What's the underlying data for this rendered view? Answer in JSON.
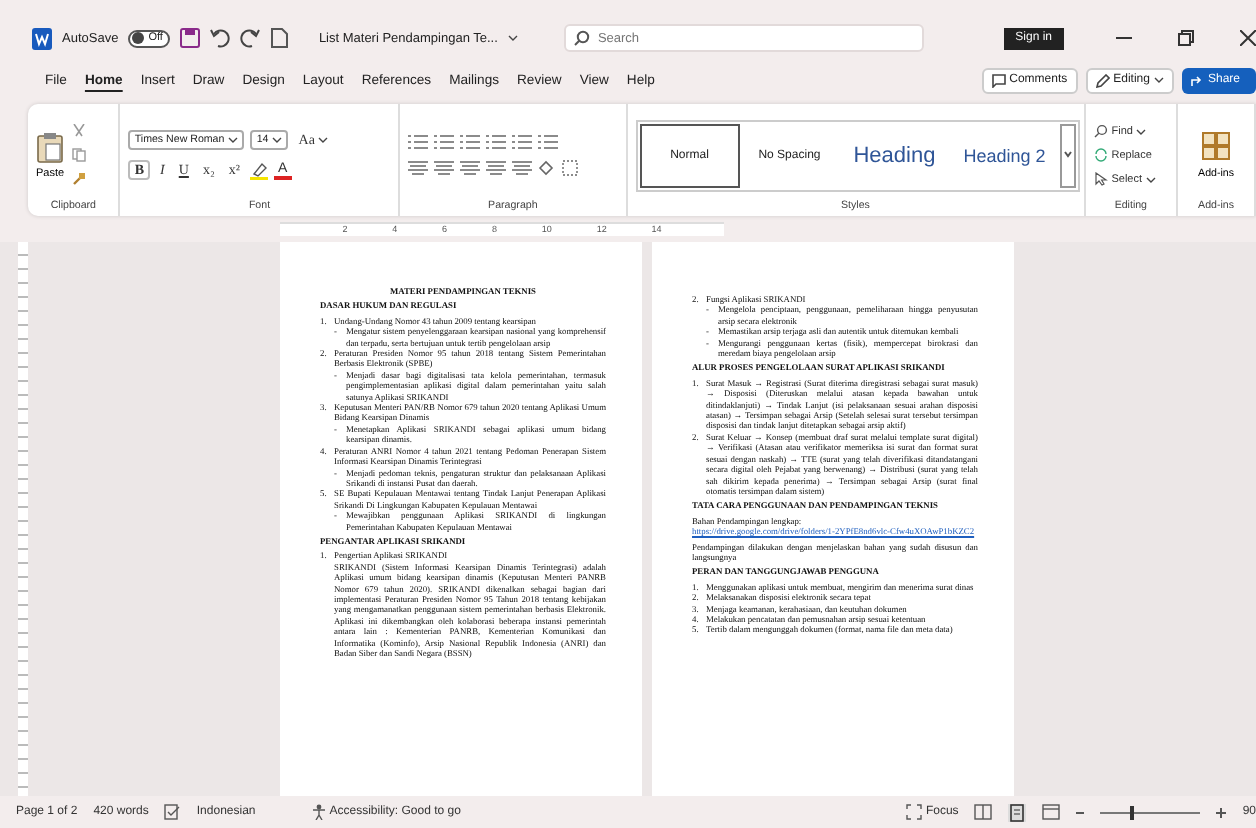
{
  "title_bar": {
    "autosave_label": "AutoSave",
    "autosave": {
      "label": "Off",
      "on": false
    },
    "document_title": "List Materi Pendampingan Te...",
    "search": {
      "placeholder": "Search"
    },
    "sign_in": "Sign in"
  },
  "menu_tabs": [
    {
      "label": "File",
      "selected": false
    },
    {
      "label": "Home",
      "selected": true
    },
    {
      "label": "Insert",
      "selected": false
    },
    {
      "label": "Draw",
      "selected": false
    },
    {
      "label": "Design",
      "selected": false
    },
    {
      "label": "Layout",
      "selected": false
    },
    {
      "label": "References",
      "selected": false
    },
    {
      "label": "Mailings",
      "selected": false
    },
    {
      "label": "Review",
      "selected": false
    },
    {
      "label": "View",
      "selected": false
    },
    {
      "label": "Help",
      "selected": false
    }
  ],
  "menu_actions": {
    "comments": "Comments",
    "editing": "Editing",
    "share": "Share"
  },
  "ribbon": {
    "clipboard": {
      "paste": "Paste",
      "label": "Clipboard"
    },
    "font": {
      "name": "Times New Roman",
      "size": "14",
      "case": "Aa",
      "format_buttons": [
        "B",
        "I",
        "U",
        "x₂",
        "x²"
      ],
      "font_color": "A",
      "label": "Font"
    },
    "paragraph": {
      "label": "Paragraph"
    },
    "styles": {
      "items": [
        {
          "label": "Normal",
          "kind": "normal",
          "selected": true
        },
        {
          "label": "No Spacing",
          "kind": "normal",
          "selected": false
        },
        {
          "label": "Heading",
          "kind": "heading1",
          "selected": false
        },
        {
          "label": "Heading 2",
          "kind": "heading2",
          "selected": false
        }
      ],
      "label": "Styles"
    },
    "editing": {
      "find": "Find",
      "replace": "Replace",
      "select": "Select",
      "label": "Editing"
    },
    "addins": {
      "button": "Add-ins",
      "label": "Add-ins"
    }
  },
  "ruler": [
    "2",
    "4",
    "6",
    "8",
    "10",
    "12",
    "14"
  ],
  "pages": [
    {
      "blocks": [
        {
          "kind": "title",
          "text": "MATERI PENDAMPINGAN TEKNIS"
        },
        {
          "kind": "heading",
          "text": "DASAR HUKUM DAN REGULASI"
        },
        {
          "kind": "item",
          "number": "1.",
          "text": "Undang-Undang Nomor 43 tahun 2009 tentang kearsipan"
        },
        {
          "kind": "sub",
          "bullet": "-",
          "text": "Mengatur sistem penyelenggaraan kearsipan nasional yang komprehensif dan terpadu, serta bertujuan untuk tertib pengelolaan arsip"
        },
        {
          "kind": "item",
          "number": "2.",
          "text": "Peraturan Presiden Nomor 95 tahun 2018 tentang Sistem Pemerintahan Berbasis Elektronik (SPBE)"
        },
        {
          "kind": "sub",
          "bullet": "-",
          "text": "Menjadi dasar bagi digitalisasi tata kelola pemerintahan, termasuk pengimplementasian aplikasi digital dalam pemerintahan yaitu salah satunya Aplikasi SRIKANDI"
        },
        {
          "kind": "item",
          "number": "3.",
          "text": "Keputusan Menteri PAN/RB Nomor 679 tahun 2020 tentang Aplikasi Umum Bidang Kearsipan Dinamis"
        },
        {
          "kind": "sub",
          "bullet": "-",
          "text": "Menetapkan Aplikasi SRIKANDI sebagai aplikasi umum bidang kearsipan dinamis."
        },
        {
          "kind": "item",
          "number": "4.",
          "text": "Peraturan ANRI Nomor 4 tahun 2021 tentang Pedoman Penerapan Sistem Informasi Kearsipan Dinamis Terintegrasi"
        },
        {
          "kind": "sub",
          "bullet": "-",
          "text": "Menjadi pedoman teknis, pengaturan struktur dan pelaksanaan Aplikasi Srikandi di instansi Pusat dan daerah."
        },
        {
          "kind": "item",
          "number": "5.",
          "text": "SE Bupati Kepulauan Mentawai tentang Tindak Lanjut Penerapan Aplikasi Srikandi Di Lingkungan Kabupaten Kepulauan Mentawai"
        },
        {
          "kind": "sub",
          "bullet": "-",
          "text": "Mewajibkan penggunaan Aplikasi SRIKANDI di lingkungan Pemerintahan Kabupaten Kepulauan Mentawai"
        },
        {
          "kind": "heading",
          "text": "PENGANTAR APLIKASI SRIKANDI"
        },
        {
          "kind": "item",
          "number": "1.",
          "text": "Pengertian Aplikasi SRIKANDI"
        },
        {
          "kind": "para",
          "text": "SRIKANDI (Sistem Informasi Kearsipan Dinamis Terintegrasi) adalah Aplikasi umum bidang kearsipan dinamis (Keputusan Menteri PANRB Nomor 679 tahun 2020). SRIKANDI dikenalkan sebagai bagian dari implementasi Peraturan Presiden Nomor 95 Tahun 2018 tentang kebijakan yang mengamanatkan penggunaan sistem pemerintahan berbasis Elektronik. Aplikasi ini dikembangkan oleh kolaborasi beberapa instansi pemerintah antara lain : Kementerian PANRB, Kementerian Komunikasi dan Informatika (Kominfo), Arsip Nasional Republik Indonesia (ANRI) dan Badan Siber dan Sandi Negara (BSSN)"
        }
      ]
    },
    {
      "blocks": [
        {
          "kind": "item",
          "number": "2.",
          "text": "Fungsi Aplikasi SRIKANDI"
        },
        {
          "kind": "sub",
          "bullet": "-",
          "text": "Mengelola penciptaan, penggunaan, pemeliharaan hingga penyusutan arsip secara elektronik"
        },
        {
          "kind": "sub",
          "bullet": "-",
          "text": "Memastikan arsip terjaga asli dan autentik untuk ditemukan kembali"
        },
        {
          "kind": "sub",
          "bullet": "-",
          "text": "Mengurangi penggunaan kertas (fisik), mempercepat birokrasi dan meredam biaya pengelolaan arsip"
        },
        {
          "kind": "heading",
          "text": "ALUR PROSES PENGELOLAAN SURAT APLIKASI SRIKANDI"
        },
        {
          "kind": "item",
          "number": "1.",
          "text": "Surat Masuk → Registrasi (Surat diterima diregistrasi sebagai surat masuk) → Disposisi (Diteruskan melalui atasan kepada bawahan untuk ditindaklanjuti) → Tindak Lanjut (isi pelaksanaan sesuai arahan disposisi atasan) → Tersimpan sebagai Arsip (Setelah selesai surat tersebut tersimpan disposisi dan tindak lanjut ditetapkan sebagai arsip aktif)"
        },
        {
          "kind": "item",
          "number": "2.",
          "text": "Surat Keluar → Konsep (membuat draf surat melalui template surat digital) → Verifikasi (Atasan atau verifikator memeriksa isi surat dan format surat sesuai dengan naskah) → TTE (surat yang telah diverifikasi ditandatangani secara digital oleh Pejabat yang berwenang) → Distribusi (surat yang telah sah dikirim kepada penerima) → Tersimpan sebagai Arsip (surat final otomatis tersimpan dalam sistem)"
        },
        {
          "kind": "heading",
          "text": "TATA CARA PENGGUNAAN DAN PENDAMPINGAN TEKNIS"
        },
        {
          "kind": "linkpara",
          "text": "Bahan Pendampingan lengkap:",
          "link": "https://drive.google.com/drive/folders/1-2YPfE8nd6vlc-Cfw4uXOAwP1bKZC2"
        },
        {
          "kind": "plain",
          "text": "Pendampingan dilakukan dengan menjelaskan bahan yang sudah disusun dan langsungnya"
        },
        {
          "kind": "heading",
          "text": "PERAN DAN TANGGUNGJAWAB PENGGUNA"
        },
        {
          "kind": "item",
          "number": "1.",
          "text": "Menggunakan aplikasi untuk membuat, mengirim dan menerima surat dinas"
        },
        {
          "kind": "item",
          "number": "2.",
          "text": "Melaksanakan disposisi elektronik secara tepat"
        },
        {
          "kind": "item",
          "number": "3.",
          "text": "Menjaga keamanan, kerahasiaan, dan keutuhan dokumen"
        },
        {
          "kind": "item",
          "number": "4.",
          "text": "Melakukan pencatatan dan pemusnahan arsip sesuai ketentuan"
        },
        {
          "kind": "item",
          "number": "5.",
          "text": "Tertib dalam mengunggah dokumen (format, nama file dan meta data)"
        }
      ]
    }
  ],
  "status_bar": {
    "page": "Page 1 of 2",
    "words": "420 words",
    "language": "Indonesian",
    "accessibility": "Accessibility: Good to go",
    "focus": "Focus",
    "zoom": {
      "level": 0.3,
      "reading": "90"
    }
  }
}
